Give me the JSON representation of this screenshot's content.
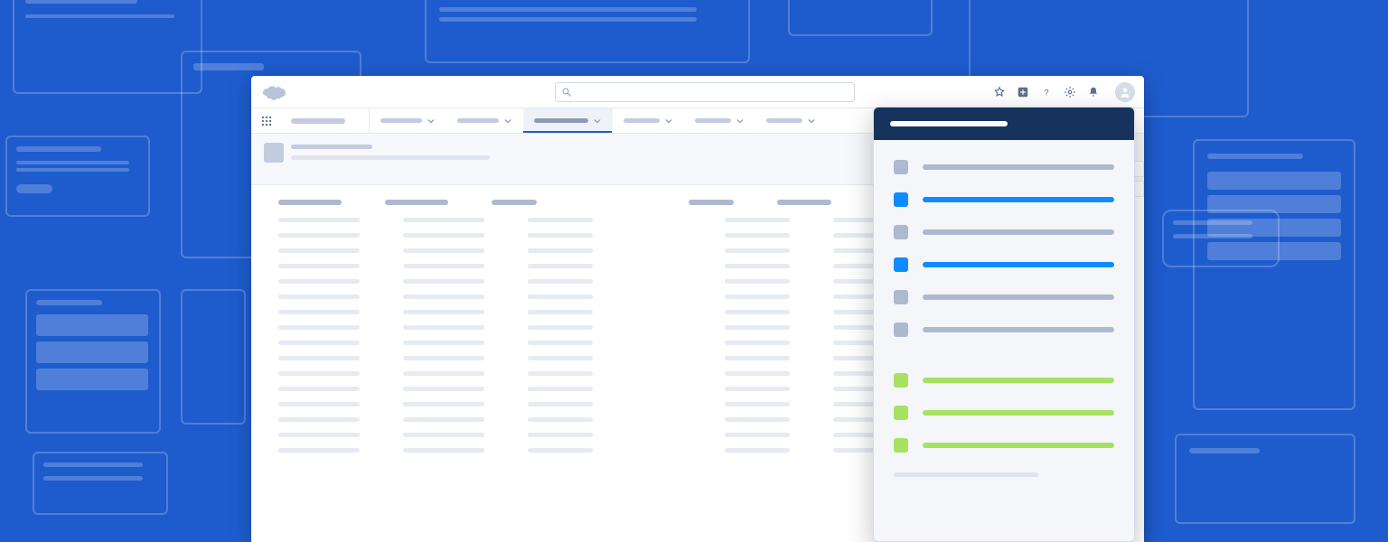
{
  "app": {
    "product": "Salesforce",
    "logo_icon": "cloud-icon"
  },
  "header": {
    "search_placeholder": "",
    "icons": [
      "favorites-icon",
      "add-icon",
      "help-icon",
      "setup-gear-icon",
      "notifications-bell-icon",
      "profile-avatar"
    ]
  },
  "navbar": {
    "app_launcher_icon": "waffle-icon",
    "brand_label": "",
    "tabs": [
      {
        "label": "",
        "active": false,
        "has_menu": true
      },
      {
        "label": "",
        "active": false,
        "has_menu": true
      },
      {
        "label": "",
        "active": true,
        "has_menu": true
      },
      {
        "label": "",
        "active": false,
        "has_menu": true
      },
      {
        "label": "",
        "active": false,
        "has_menu": true
      },
      {
        "label": "",
        "active": false,
        "has_menu": true
      }
    ]
  },
  "page": {
    "object_icon": "record-icon",
    "title": "",
    "subtitle": "",
    "filters": [
      "",
      "",
      "",
      "",
      ""
    ],
    "side_buttons": [
      "",
      ""
    ],
    "table": {
      "columns": [
        "",
        "",
        "",
        "",
        ""
      ],
      "row_count": 16
    }
  },
  "panel": {
    "title": "",
    "sections": [
      {
        "items": [
          {
            "color": "grey",
            "label": ""
          },
          {
            "color": "blue",
            "label": ""
          },
          {
            "color": "grey",
            "label": ""
          },
          {
            "color": "blue",
            "label": ""
          },
          {
            "color": "grey",
            "label": ""
          },
          {
            "color": "grey",
            "label": ""
          }
        ]
      },
      {
        "items": [
          {
            "color": "green",
            "label": ""
          },
          {
            "color": "green",
            "label": ""
          },
          {
            "color": "green",
            "label": ""
          }
        ]
      }
    ],
    "footer": ""
  },
  "colors": {
    "brand_blue": "#1e5cce",
    "panel_header": "#17325d",
    "accent_blue": "#0d8bff",
    "accent_green": "#a7e163",
    "neutral": "#aeb8cf"
  }
}
